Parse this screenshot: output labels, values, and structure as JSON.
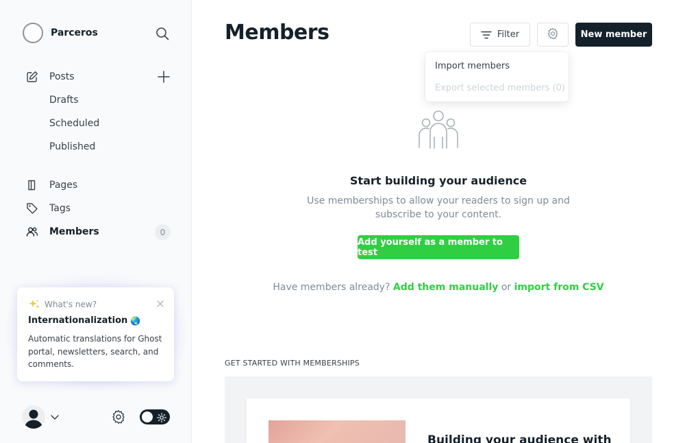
{
  "brand": {
    "name": "Parceros"
  },
  "nav": {
    "posts": "Posts",
    "drafts": "Drafts",
    "scheduled": "Scheduled",
    "published": "Published",
    "pages": "Pages",
    "tags": "Tags",
    "members": "Members",
    "members_count": "0"
  },
  "whats_new": {
    "header": "What's new?",
    "title": "Internationalization",
    "emoji": "🌏",
    "text": "Automatic translations for Ghost portal, newsletters, search, and comments."
  },
  "header": {
    "title": "Members",
    "filter_label": "Filter",
    "new_member_label": "New member"
  },
  "dropdown": {
    "import": "Import members",
    "export": "Export selected members (0)"
  },
  "empty_state": {
    "title": "Start building your audience",
    "description": "Use memberships to allow your readers to sign up and subscribe to your content.",
    "cta": "Add yourself as a member to test",
    "have_members": "Have members already?",
    "add_manually": "Add them manually",
    "or": "or",
    "import_csv": "import from CSV"
  },
  "get_started": {
    "label": "GET STARTED WITH MEMBERSHIPS",
    "card_title": "Building your audience with"
  },
  "colors": {
    "accent_green": "#30cf43",
    "dark": "#15212a",
    "muted": "#7c8b9a"
  }
}
